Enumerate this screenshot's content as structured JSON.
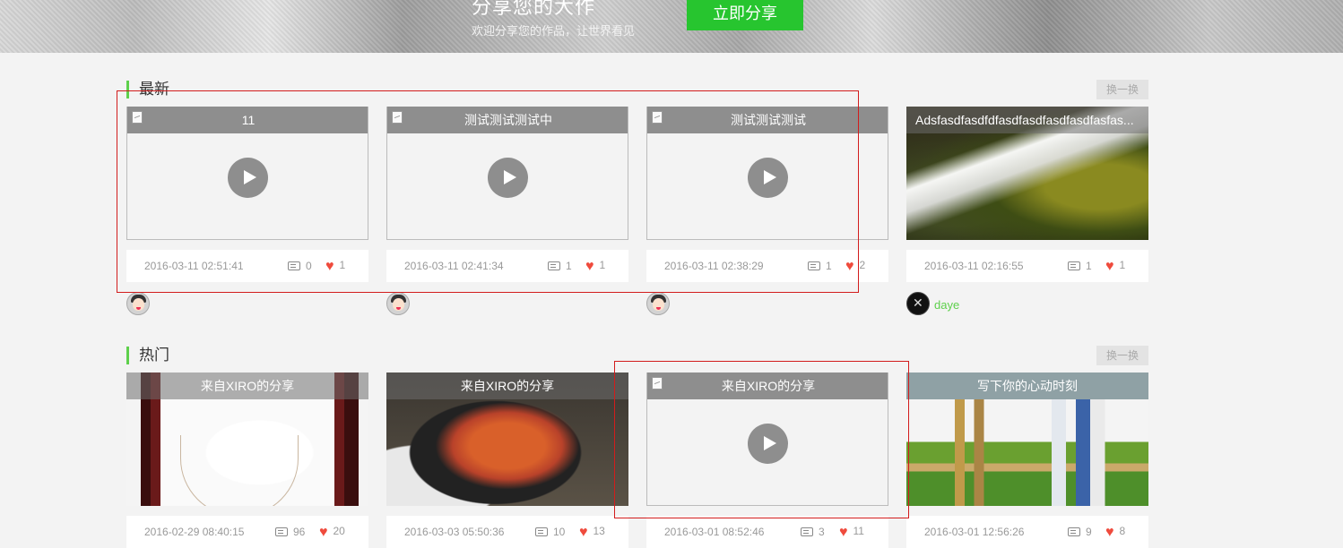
{
  "banner": {
    "title": "分享您的大作",
    "subtitle": "欢迎分享您的作品，让世界看见",
    "share_button": "立即分享"
  },
  "sections": {
    "latest": {
      "title": "最新",
      "refresh": "换一换",
      "cards": [
        {
          "caption": "11",
          "date": "2016-03-11 02:51:41",
          "comments": "0",
          "likes": "1",
          "media": "video"
        },
        {
          "caption": "测试测试测试中",
          "date": "2016-03-11 02:41:34",
          "comments": "1",
          "likes": "1",
          "media": "video"
        },
        {
          "caption": "测试测试测试",
          "date": "2016-03-11 02:38:29",
          "comments": "1",
          "likes": "2",
          "media": "video"
        },
        {
          "caption": "Adsfasdfasdfdfasdfasdfasdfasdfasfas...",
          "date": "2016-03-11 02:16:55",
          "comments": "1",
          "likes": "1",
          "media": "image-waterfall",
          "username": "daye"
        }
      ]
    },
    "hot": {
      "title": "热门",
      "refresh": "换一换",
      "cards": [
        {
          "caption": "来自XIRO的分享",
          "date": "2016-02-29 08:40:15",
          "comments": "96",
          "likes": "20",
          "media": "image-necklace"
        },
        {
          "caption": "来自XIRO的分享",
          "date": "2016-03-03 05:50:36",
          "comments": "10",
          "likes": "13",
          "media": "image-food"
        },
        {
          "caption": "来自XIRO的分享",
          "date": "2016-03-01 08:52:46",
          "comments": "3",
          "likes": "11",
          "media": "video"
        },
        {
          "caption": "写下你的心动时刻",
          "date": "2016-03-01 12:56:26",
          "comments": "9",
          "likes": "8",
          "media": "image-city"
        }
      ]
    }
  },
  "icons": {
    "comment": "comment-icon",
    "like": "heart-icon",
    "play": "play-icon",
    "broken_image": "broken-image-icon"
  },
  "colors": {
    "accent_green": "#27c52f",
    "section_marker": "#5ed04c",
    "like_red": "#ef4b3d",
    "annotation_red": "#d21c1c"
  }
}
